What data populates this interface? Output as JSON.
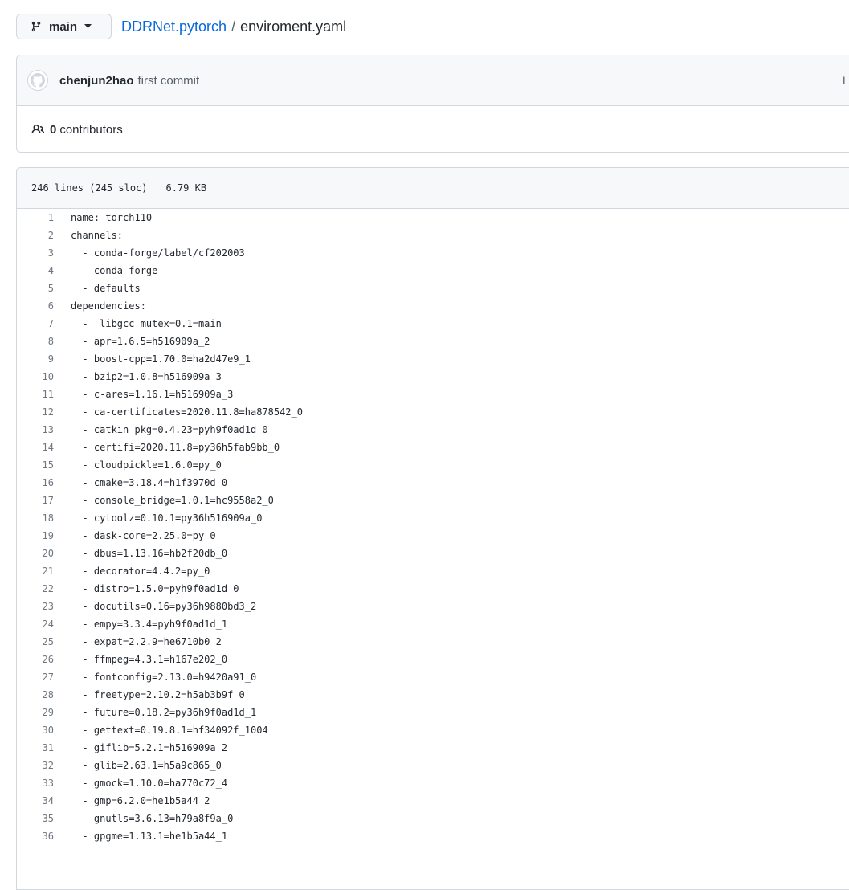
{
  "header": {
    "branch_label": "main",
    "repo_name": "DDRNet.pytorch",
    "separator": "/",
    "file_name": "enviroment.yaml"
  },
  "commit": {
    "author": "chenjun2hao",
    "message": "first commit",
    "latest_label": "L"
  },
  "contributors": {
    "count": "0",
    "label": "contributors"
  },
  "file_info": {
    "lines": "246 lines (245 sloc)",
    "size": "6.79 KB"
  },
  "code_lines": [
    {
      "n": "1",
      "text": "name: torch110"
    },
    {
      "n": "2",
      "text": "channels:"
    },
    {
      "n": "3",
      "text": "  - conda-forge/label/cf202003"
    },
    {
      "n": "4",
      "text": "  - conda-forge"
    },
    {
      "n": "5",
      "text": "  - defaults"
    },
    {
      "n": "6",
      "text": "dependencies:"
    },
    {
      "n": "7",
      "text": "  - _libgcc_mutex=0.1=main"
    },
    {
      "n": "8",
      "text": "  - apr=1.6.5=h516909a_2"
    },
    {
      "n": "9",
      "text": "  - boost-cpp=1.70.0=ha2d47e9_1"
    },
    {
      "n": "10",
      "text": "  - bzip2=1.0.8=h516909a_3"
    },
    {
      "n": "11",
      "text": "  - c-ares=1.16.1=h516909a_3"
    },
    {
      "n": "12",
      "text": "  - ca-certificates=2020.11.8=ha878542_0"
    },
    {
      "n": "13",
      "text": "  - catkin_pkg=0.4.23=pyh9f0ad1d_0"
    },
    {
      "n": "14",
      "text": "  - certifi=2020.11.8=py36h5fab9bb_0"
    },
    {
      "n": "15",
      "text": "  - cloudpickle=1.6.0=py_0"
    },
    {
      "n": "16",
      "text": "  - cmake=3.18.4=h1f3970d_0"
    },
    {
      "n": "17",
      "text": "  - console_bridge=1.0.1=hc9558a2_0"
    },
    {
      "n": "18",
      "text": "  - cytoolz=0.10.1=py36h516909a_0"
    },
    {
      "n": "19",
      "text": "  - dask-core=2.25.0=py_0"
    },
    {
      "n": "20",
      "text": "  - dbus=1.13.16=hb2f20db_0"
    },
    {
      "n": "21",
      "text": "  - decorator=4.4.2=py_0"
    },
    {
      "n": "22",
      "text": "  - distro=1.5.0=pyh9f0ad1d_0"
    },
    {
      "n": "23",
      "text": "  - docutils=0.16=py36h9880bd3_2"
    },
    {
      "n": "24",
      "text": "  - empy=3.3.4=pyh9f0ad1d_1"
    },
    {
      "n": "25",
      "text": "  - expat=2.2.9=he6710b0_2"
    },
    {
      "n": "26",
      "text": "  - ffmpeg=4.3.1=h167e202_0"
    },
    {
      "n": "27",
      "text": "  - fontconfig=2.13.0=h9420a91_0"
    },
    {
      "n": "28",
      "text": "  - freetype=2.10.2=h5ab3b9f_0"
    },
    {
      "n": "29",
      "text": "  - future=0.18.2=py36h9f0ad1d_1"
    },
    {
      "n": "30",
      "text": "  - gettext=0.19.8.1=hf34092f_1004"
    },
    {
      "n": "31",
      "text": "  - giflib=5.2.1=h516909a_2"
    },
    {
      "n": "32",
      "text": "  - glib=2.63.1=h5a9c865_0"
    },
    {
      "n": "33",
      "text": "  - gmock=1.10.0=ha770c72_4"
    },
    {
      "n": "34",
      "text": "  - gmp=6.2.0=he1b5a44_2"
    },
    {
      "n": "35",
      "text": "  - gnutls=3.6.13=h79a8f9a_0"
    },
    {
      "n": "36",
      "text": "  - gpgme=1.13.1=he1b5a44_1"
    }
  ]
}
